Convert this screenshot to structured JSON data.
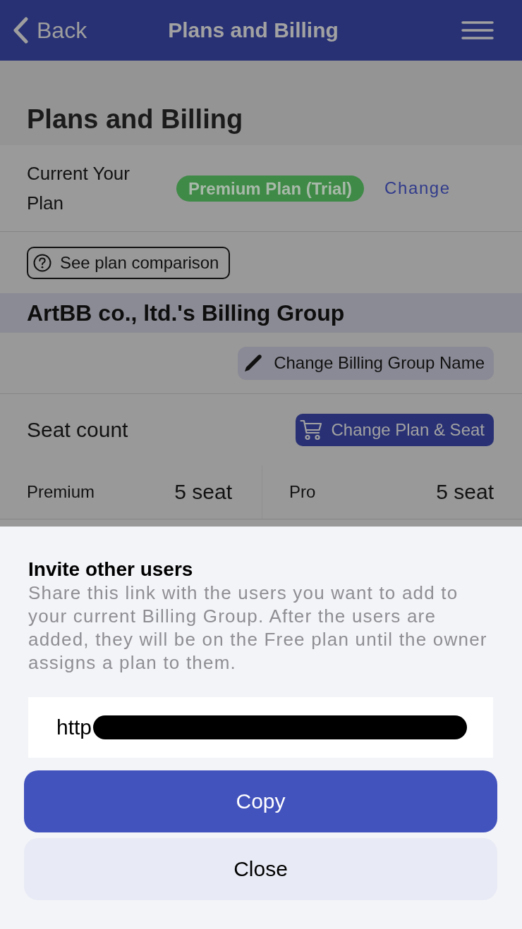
{
  "header": {
    "back_label": "Back",
    "title": "Plans and Billing"
  },
  "page": {
    "heading": "Plans and Billing",
    "current_plan": {
      "label": "Current Your Plan",
      "badge": "Premium Plan (Trial)",
      "change_link": "Change"
    },
    "comparison_button": "See plan comparison",
    "billing_group": {
      "name": "ArtBB co., ltd.'s Billing Group",
      "rename_button": "Change Billing Group Name"
    },
    "seats": {
      "label": "Seat count",
      "change_button": "Change Plan & Seat",
      "plans": [
        {
          "name": "Premium",
          "count": "5 seat"
        },
        {
          "name": "Pro",
          "count": "5 seat"
        }
      ]
    }
  },
  "invite_sheet": {
    "title": "Invite other users",
    "description": "Share this link with the users you want to add to your current Billing Group. After the users are added, they will be on the Free plan until the owner assigns a plan to them.",
    "link_field": {
      "value": "http",
      "redacted": true
    },
    "buttons": [
      {
        "label": "Copy",
        "kind": "primary"
      },
      {
        "label": "Close",
        "kind": "secondary"
      }
    ]
  }
}
